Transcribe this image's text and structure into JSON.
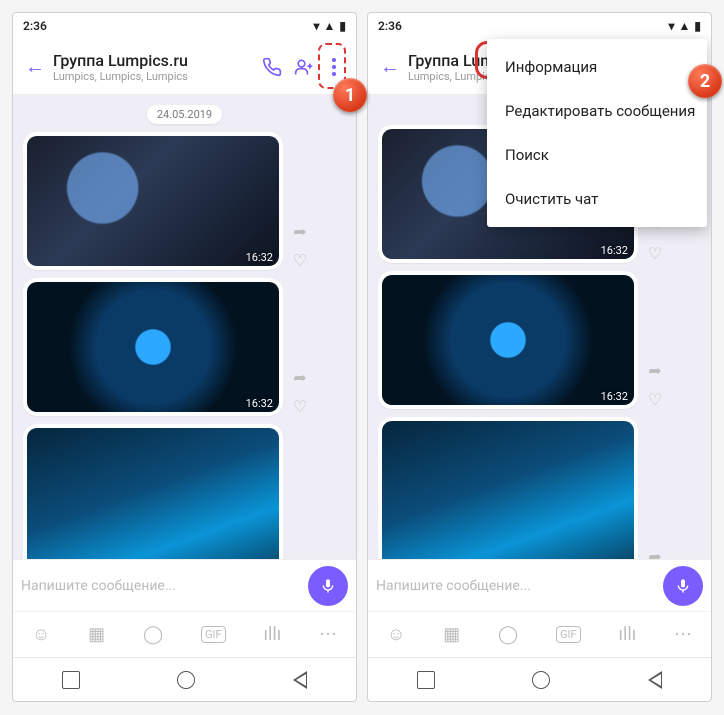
{
  "status": {
    "time": "2:36"
  },
  "header": {
    "title": "Группа Lumpics.ru",
    "subtitle": "Lumpics, Lumpics, Lumpics"
  },
  "chat": {
    "date_label": "24.05.2019",
    "msg_time": "16:32"
  },
  "input": {
    "placeholder": "Напишите сообщение..."
  },
  "menu": {
    "items": [
      "Информация",
      "Редактировать сообщения",
      "Поиск",
      "Очистить чат"
    ]
  },
  "callouts": {
    "one": "1",
    "two": "2"
  }
}
